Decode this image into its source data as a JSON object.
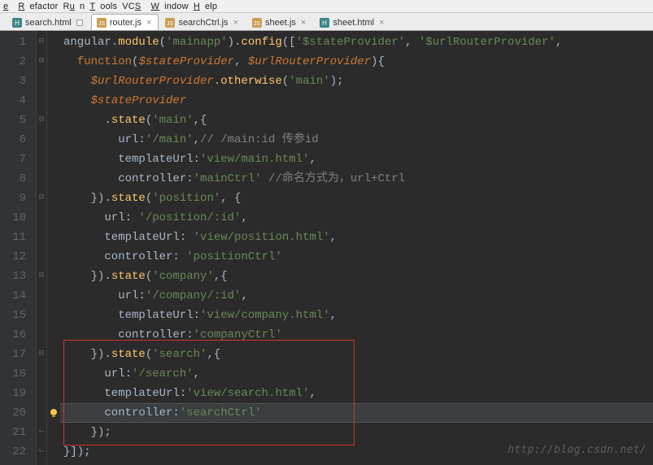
{
  "menu": {
    "items": [
      {
        "label": "e",
        "mnemonic_index": 0
      },
      {
        "label": "Refactor",
        "mnemonic_index": 0
      },
      {
        "label": "Run",
        "mnemonic_index": 1
      },
      {
        "label": "Tools",
        "mnemonic_index": 0
      },
      {
        "label": "VCS",
        "mnemonic_index": 2
      },
      {
        "label": "Window",
        "mnemonic_index": 0
      },
      {
        "label": "Help",
        "mnemonic_index": 0
      }
    ]
  },
  "tabs": [
    {
      "label": "search.html",
      "icon": "html",
      "active": false,
      "pinned": true
    },
    {
      "label": "router.js",
      "icon": "js",
      "active": true,
      "pinned": false
    },
    {
      "label": "searchCtrl.js",
      "icon": "js",
      "active": false,
      "pinned": false
    },
    {
      "label": "sheet.js",
      "icon": "js",
      "active": false,
      "pinned": false
    },
    {
      "label": "sheet.html",
      "icon": "html",
      "active": false,
      "pinned": false
    }
  ],
  "editor": {
    "current_line": 20,
    "bulb_line": 20,
    "highlight_box": {
      "from_line": 17,
      "to_line": 21,
      "note": "red rectangle around .state('search',{...})"
    },
    "lines": [
      {
        "n": 1,
        "fold": "open",
        "tokens": [
          [
            "default",
            "angular."
          ],
          [
            "method",
            "module"
          ],
          [
            "punc",
            "("
          ],
          [
            "string",
            "'mainapp'"
          ],
          [
            "punc",
            ")."
          ],
          [
            "method",
            "config"
          ],
          [
            "punc",
            "(["
          ],
          [
            "string",
            "'$stateProvider'"
          ],
          [
            "punc",
            ", "
          ],
          [
            "string",
            "'$urlRouterProvider'"
          ],
          [
            "punc",
            ","
          ]
        ]
      },
      {
        "n": 2,
        "fold": "open",
        "tokens": [
          [
            "default",
            "  "
          ],
          [
            "keyword",
            "function"
          ],
          [
            "punc",
            "("
          ],
          [
            "param",
            "$stateProvider"
          ],
          [
            "punc",
            ", "
          ],
          [
            "param",
            "$urlRouterProvider"
          ],
          [
            "punc",
            "){"
          ]
        ]
      },
      {
        "n": 3,
        "fold": "",
        "tokens": [
          [
            "default",
            "    "
          ],
          [
            "italic-orange",
            "$urlRouterProvider"
          ],
          [
            "punc",
            "."
          ],
          [
            "method",
            "otherwise"
          ],
          [
            "punc",
            "("
          ],
          [
            "string",
            "'main'"
          ],
          [
            "punc",
            ");"
          ]
        ]
      },
      {
        "n": 4,
        "fold": "",
        "tokens": [
          [
            "default",
            "    "
          ],
          [
            "italic-orange",
            "$stateProvider"
          ]
        ]
      },
      {
        "n": 5,
        "fold": "open",
        "tokens": [
          [
            "default",
            "      ."
          ],
          [
            "method",
            "state"
          ],
          [
            "punc",
            "("
          ],
          [
            "string",
            "'main'"
          ],
          [
            "punc",
            ",{"
          ]
        ]
      },
      {
        "n": 6,
        "fold": "",
        "tokens": [
          [
            "default",
            "        url:"
          ],
          [
            "string",
            "'/main'"
          ],
          [
            "punc",
            ","
          ],
          [
            "comment",
            "// /main:id 传参id"
          ]
        ]
      },
      {
        "n": 7,
        "fold": "",
        "tokens": [
          [
            "default",
            "        templateUrl:"
          ],
          [
            "string",
            "'view/main.html'"
          ],
          [
            "punc",
            ","
          ]
        ]
      },
      {
        "n": 8,
        "fold": "",
        "tokens": [
          [
            "default",
            "        controller:"
          ],
          [
            "string",
            "'mainCtrl'"
          ],
          [
            "default",
            " "
          ],
          [
            "comment",
            "//命名方式为，url+Ctrl"
          ]
        ]
      },
      {
        "n": 9,
        "fold": "open",
        "tokens": [
          [
            "default",
            "    })."
          ],
          [
            "method",
            "state"
          ],
          [
            "punc",
            "("
          ],
          [
            "string",
            "'position'"
          ],
          [
            "punc",
            ", {"
          ]
        ]
      },
      {
        "n": 10,
        "fold": "",
        "tokens": [
          [
            "default",
            "      url: "
          ],
          [
            "string",
            "'/position/:id'"
          ],
          [
            "punc",
            ","
          ]
        ]
      },
      {
        "n": 11,
        "fold": "",
        "tokens": [
          [
            "default",
            "      templateUrl: "
          ],
          [
            "string",
            "'view/position.html'"
          ],
          [
            "punc",
            ","
          ]
        ]
      },
      {
        "n": 12,
        "fold": "",
        "tokens": [
          [
            "default",
            "      controller: "
          ],
          [
            "string",
            "'positionCtrl'"
          ]
        ]
      },
      {
        "n": 13,
        "fold": "open",
        "tokens": [
          [
            "default",
            "    })."
          ],
          [
            "method",
            "state"
          ],
          [
            "punc",
            "("
          ],
          [
            "string",
            "'company'"
          ],
          [
            "punc",
            ",{"
          ]
        ]
      },
      {
        "n": 14,
        "fold": "",
        "tokens": [
          [
            "default",
            "        url:"
          ],
          [
            "string",
            "'/company/:id'"
          ],
          [
            "punc",
            ","
          ]
        ]
      },
      {
        "n": 15,
        "fold": "",
        "tokens": [
          [
            "default",
            "        templateUrl:"
          ],
          [
            "string",
            "'view/company.html'"
          ],
          [
            "punc",
            ","
          ]
        ]
      },
      {
        "n": 16,
        "fold": "",
        "tokens": [
          [
            "default",
            "        controller:"
          ],
          [
            "string",
            "'companyCtrl'"
          ]
        ]
      },
      {
        "n": 17,
        "fold": "open",
        "tokens": [
          [
            "default",
            "    })."
          ],
          [
            "method",
            "state"
          ],
          [
            "punc",
            "("
          ],
          [
            "string",
            "'search'"
          ],
          [
            "punc",
            ",{"
          ]
        ]
      },
      {
        "n": 18,
        "fold": "",
        "tokens": [
          [
            "default",
            "      url:"
          ],
          [
            "string",
            "'/search'"
          ],
          [
            "punc",
            ","
          ]
        ]
      },
      {
        "n": 19,
        "fold": "",
        "tokens": [
          [
            "default",
            "      templateUrl:"
          ],
          [
            "string",
            "'view/search.html'"
          ],
          [
            "punc",
            ","
          ]
        ]
      },
      {
        "n": 20,
        "fold": "",
        "tokens": [
          [
            "default",
            "      controller:"
          ],
          [
            "string",
            "'searchCtrl'"
          ]
        ]
      },
      {
        "n": 21,
        "fold": "close",
        "tokens": [
          [
            "default",
            "    });"
          ]
        ]
      },
      {
        "n": 22,
        "fold": "close",
        "tokens": [
          [
            "default",
            "}]);"
          ]
        ]
      }
    ]
  },
  "watermark": "http://blog.csdn.net/"
}
